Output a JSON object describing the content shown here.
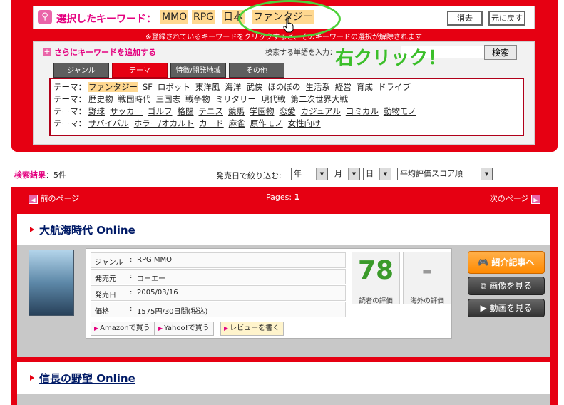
{
  "keyword_panel": {
    "title": "選択したキーワード：",
    "selected_keywords": [
      "MMO",
      "RPG",
      "日本",
      "ファンタジー"
    ],
    "clear_label": "消去",
    "undo_label": "元に戻す",
    "note": "※登録されているキーワードをクリックすると、そのキーワードの選択が解除されます",
    "add_label": "さらにキーワードを追加する",
    "search_label": "検索する単語を入力：",
    "search_value": "",
    "search_button": "検索",
    "tabs": [
      "ジャンル",
      "テーマ",
      "特徴/開発地域",
      "その他"
    ],
    "active_tab": "テーマ",
    "row_label": "テーマ：",
    "rows": [
      [
        "ファンタジー",
        "SF",
        "ロボット",
        "東洋風",
        "海洋",
        "武侠",
        "ほのぼの",
        "生活系",
        "経営",
        "育成",
        "ドライブ"
      ],
      [
        "歴史物",
        "戦国時代",
        "三国志",
        "戦争物",
        "ミリタリー",
        "現代戦",
        "第二次世界大戦"
      ],
      [
        "野球",
        "サッカー",
        "ゴルフ",
        "格闘",
        "テニス",
        "競馬",
        "学園物",
        "恋愛",
        "カジュアル",
        "コミカル",
        "動物モノ"
      ],
      [
        "サバイバル",
        "ホラー/オカルト",
        "カード",
        "麻雀",
        "原作モノ",
        "女性向け"
      ]
    ],
    "annotation": "右クリック！"
  },
  "results": {
    "count_label": "検索結果",
    "count_value": "：5件",
    "filter_label": "発売日で絞り込む:",
    "filter_year": "年",
    "filter_month": "月",
    "filter_day": "日",
    "sort": "平均評価スコア順",
    "prev_label": "前のページ",
    "pages_label": "Pages: ",
    "page_number": "1",
    "next_label": "次のページ"
  },
  "games": [
    {
      "name": "大航海時代 Online",
      "genre_key": "ジャンル",
      "genre": "RPG  MMO",
      "maker_key": "発売元",
      "maker": "コーエー",
      "date_key": "発売日",
      "date": "2005/03/16",
      "price_key": "価格",
      "price": "1575円/30日間(税込)",
      "reader_score": "78",
      "reader_label": "読者の評価",
      "foreign_score": "-",
      "foreign_label": "海外の評価",
      "amazon": "Amazonで買う",
      "yahoo": "Yahoo!で買う",
      "review": "レビューを書く",
      "intro_button": "紹介記事へ",
      "image_button": "画像を見る",
      "video_button": "動画を見る"
    },
    {
      "name": "信長の野望 Online"
    }
  ],
  "colors": {
    "brand_red": "#e60012",
    "accent_pink": "#e4007f",
    "chip": "#ffd890",
    "annot_green": "#3bbf2a"
  }
}
